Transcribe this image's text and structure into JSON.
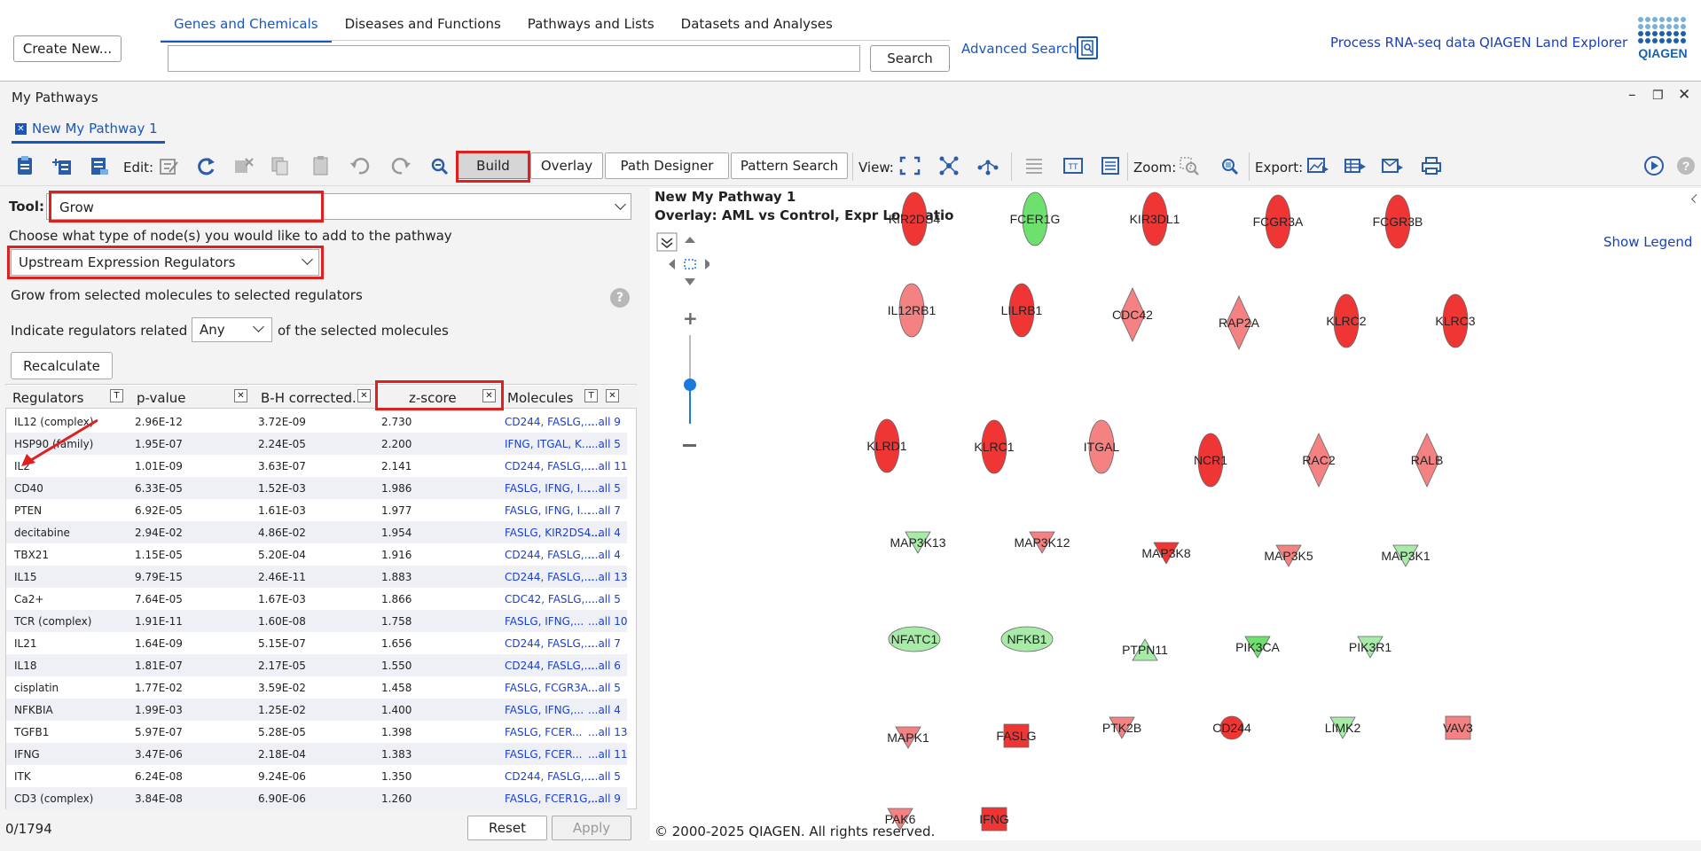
{
  "topnav": {
    "create_button": "Create New...",
    "tabs": [
      "Genes and Chemicals",
      "Diseases and Functions",
      "Pathways and Lists",
      "Datasets and Analyses"
    ],
    "search_value": "",
    "search_button": "Search",
    "advanced_search": "Advanced Search",
    "process_rnaseq": "Process RNA-seq data",
    "land_explorer": "QIAGEN Land Explorer",
    "logo_text": "QIAGEN"
  },
  "panel": {
    "title": "My Pathways",
    "tab_label": "New My Pathway 1"
  },
  "toolbar": {
    "edit_label": "Edit:",
    "build": "Build",
    "overlay": "Overlay",
    "path_designer": "Path Designer",
    "pattern_search": "Pattern Search",
    "view_label": "View:",
    "zoom_label": "Zoom:",
    "export_label": "Export:"
  },
  "left": {
    "tool_label": "Tool:",
    "tool_value": "Grow",
    "choose_text": "Choose what type of node(s) you would like to add to the pathway",
    "node_type_value": "Upstream Expression Regulators",
    "grow_text": "Grow from selected molecules to selected regulators",
    "indicate_prefix": "Indicate regulators related to",
    "any_value": "Any",
    "indicate_suffix": "of the selected molecules",
    "recalculate": "Recalculate",
    "columns": [
      "Regulators",
      "p-value",
      "B-H corrected...",
      "z-score",
      "Molecules"
    ],
    "rows": [
      {
        "reg": "IL12 (complex)",
        "p": "2.96E-12",
        "bh": "3.72E-09",
        "z": "2.730",
        "mol": "CD244, FASLG,...",
        "all": "...all 9"
      },
      {
        "reg": "HSP90 (family)",
        "p": "1.95E-07",
        "bh": "2.24E-05",
        "z": "2.200",
        "mol": "IFNG, ITGAL, K...",
        "all": "...all 5"
      },
      {
        "reg": "IL2",
        "p": "1.01E-09",
        "bh": "3.63E-07",
        "z": "2.141",
        "mol": "CD244, FASLG,...",
        "all": "...all 11"
      },
      {
        "reg": "CD40",
        "p": "6.33E-05",
        "bh": "1.52E-03",
        "z": "1.986",
        "mol": "FASLG, IFNG, I...",
        "all": "...all 5"
      },
      {
        "reg": "PTEN",
        "p": "6.92E-05",
        "bh": "1.61E-03",
        "z": "1.977",
        "mol": "FASLG, IFNG, I...",
        "all": "...all 7"
      },
      {
        "reg": "decitabine",
        "p": "2.94E-02",
        "bh": "4.86E-02",
        "z": "1.954",
        "mol": "FASLG, KIR2DS4...",
        "all": "...all 4"
      },
      {
        "reg": "TBX21",
        "p": "1.15E-05",
        "bh": "5.20E-04",
        "z": "1.916",
        "mol": "CD244, FASLG,...",
        "all": "...all 4"
      },
      {
        "reg": "IL15",
        "p": "9.79E-15",
        "bh": "2.46E-11",
        "z": "1.883",
        "mol": "CD244, FASLG,...",
        "all": "...all 13"
      },
      {
        "reg": "Ca2+",
        "p": "7.64E-05",
        "bh": "1.67E-03",
        "z": "1.866",
        "mol": "CDC42, FASLG,...",
        "all": "...all 5"
      },
      {
        "reg": "TCR (complex)",
        "p": "1.91E-11",
        "bh": "1.60E-08",
        "z": "1.758",
        "mol": "FASLG, IFNG,...",
        "all": "...all 10"
      },
      {
        "reg": "IL21",
        "p": "1.64E-09",
        "bh": "5.15E-07",
        "z": "1.656",
        "mol": "CD244, FASLG,...",
        "all": "...all 7"
      },
      {
        "reg": "IL18",
        "p": "1.81E-07",
        "bh": "2.17E-05",
        "z": "1.550",
        "mol": "CD244, FASLG,...",
        "all": "...all 6"
      },
      {
        "reg": "cisplatin",
        "p": "1.77E-02",
        "bh": "3.59E-02",
        "z": "1.458",
        "mol": "FASLG, FCGR3A...",
        "all": "...all 5"
      },
      {
        "reg": "NFKBIA",
        "p": "1.99E-03",
        "bh": "1.25E-02",
        "z": "1.400",
        "mol": "FASLG, IFNG,...",
        "all": "...all 4"
      },
      {
        "reg": "TGFB1",
        "p": "5.97E-07",
        "bh": "5.28E-05",
        "z": "1.398",
        "mol": "FASLG, FCER...",
        "all": "...all 13"
      },
      {
        "reg": "IFNG",
        "p": "3.47E-06",
        "bh": "2.18E-04",
        "z": "1.383",
        "mol": "FASLG, FCER...",
        "all": "...all 11"
      },
      {
        "reg": "ITK",
        "p": "6.24E-08",
        "bh": "9.24E-06",
        "z": "1.350",
        "mol": "CD244, FASLG,...",
        "all": "...all 5"
      },
      {
        "reg": "CD3 (complex)",
        "p": "3.84E-08",
        "bh": "6.90E-06",
        "z": "1.260",
        "mol": "FASLG, FCER1G,...",
        "all": "...all 9"
      }
    ],
    "count": "0/1794",
    "reset": "Reset",
    "apply": "Apply"
  },
  "canvas": {
    "title": "New My Pathway 1",
    "overlay": "Overlay: AML vs Control, Expr Log Ratio",
    "show_legend": "Show Legend",
    "copyright": "© 2000-2025 QIAGEN. All rights reserved.",
    "colors": {
      "red": "#f03535",
      "lightred": "#f48282",
      "green": "#6de06d",
      "lightgreen": "#a8eba8"
    },
    "nodes": [
      {
        "label": "KIR2DS4",
        "shape": "ellipse",
        "color": "red"
      },
      {
        "label": "FCER1G",
        "shape": "ellipse",
        "color": "green"
      },
      {
        "label": "KIR3DL1",
        "shape": "ellipse",
        "color": "red"
      },
      {
        "label": "FCGR3A",
        "shape": "ellipse",
        "color": "red"
      },
      {
        "label": "FCGR3B",
        "shape": "ellipse",
        "color": "red"
      },
      {
        "label": "IL12RB1",
        "shape": "ellipse",
        "color": "lightred"
      },
      {
        "label": "LILRB1",
        "shape": "ellipse",
        "color": "red"
      },
      {
        "label": "CDC42",
        "shape": "diamond",
        "color": "lightred"
      },
      {
        "label": "RAP2A",
        "shape": "diamond",
        "color": "lightred"
      },
      {
        "label": "KLRC2",
        "shape": "ellipse",
        "color": "red"
      },
      {
        "label": "KLRC3",
        "shape": "ellipse",
        "color": "red"
      },
      {
        "label": "KLRD1",
        "shape": "ellipse",
        "color": "red"
      },
      {
        "label": "KLRC1",
        "shape": "ellipse",
        "color": "red"
      },
      {
        "label": "ITGAL",
        "shape": "ellipse",
        "color": "lightred"
      },
      {
        "label": "NCR1",
        "shape": "ellipse",
        "color": "red"
      },
      {
        "label": "RAC2",
        "shape": "diamond",
        "color": "lightred"
      },
      {
        "label": "RALB",
        "shape": "diamond",
        "color": "lightred"
      },
      {
        "label": "MAP3K13",
        "shape": "vtri",
        "color": "lightgreen"
      },
      {
        "label": "MAP3K12",
        "shape": "vtri",
        "color": "lightred"
      },
      {
        "label": "MAP3K8",
        "shape": "vtri",
        "color": "red"
      },
      {
        "label": "MAP3K5",
        "shape": "vtri",
        "color": "lightred"
      },
      {
        "label": "MAP3K1",
        "shape": "vtri",
        "color": "lightgreen"
      },
      {
        "label": "NFATC1",
        "shape": "hellipse",
        "color": "lightgreen"
      },
      {
        "label": "NFKB1",
        "shape": "hellipse",
        "color": "lightgreen"
      },
      {
        "label": "PTPN11",
        "shape": "utri",
        "color": "lightgreen"
      },
      {
        "label": "PIK3CA",
        "shape": "vtri",
        "color": "green"
      },
      {
        "label": "PIK3R1",
        "shape": "vtri",
        "color": "lightgreen"
      },
      {
        "label": "MAPK1",
        "shape": "vtri",
        "color": "lightred"
      },
      {
        "label": "FASLG",
        "shape": "square",
        "color": "red"
      },
      {
        "label": "PTK2B",
        "shape": "vtri",
        "color": "lightred"
      },
      {
        "label": "CD244",
        "shape": "circle",
        "color": "red"
      },
      {
        "label": "LIMK2",
        "shape": "vtri",
        "color": "lightgreen"
      },
      {
        "label": "VAV3",
        "shape": "square",
        "color": "lightred"
      },
      {
        "label": "PAK6",
        "shape": "vtri",
        "color": "lightred"
      },
      {
        "label": "IFNG",
        "shape": "square",
        "color": "red"
      }
    ]
  }
}
